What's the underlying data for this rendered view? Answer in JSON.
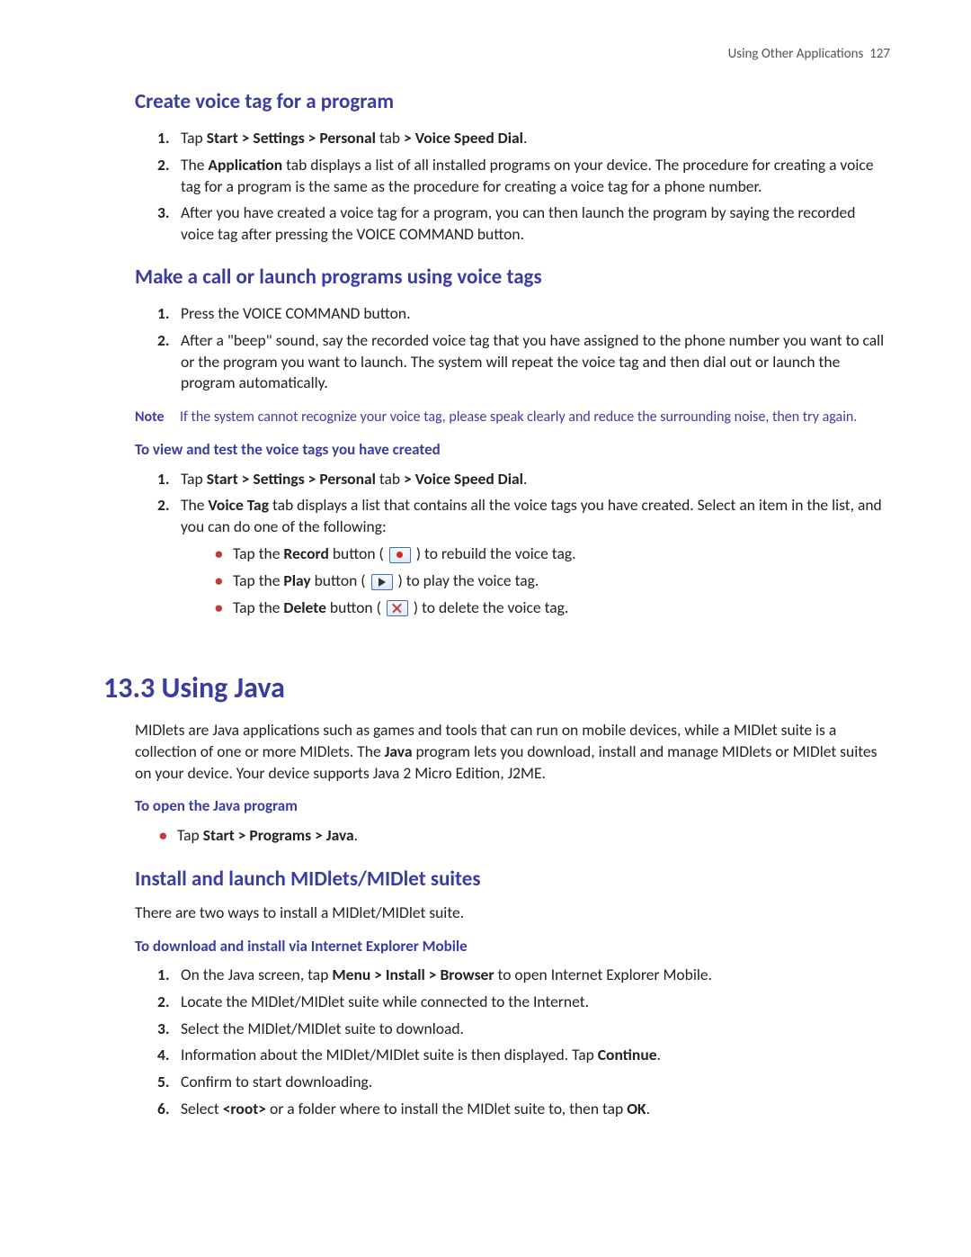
{
  "header": {
    "section": "Using Other Applications",
    "page": "127"
  },
  "s1": {
    "title": "Create voice tag for a program",
    "li1a": "Tap ",
    "li1b": "Start > Settings > Personal",
    "li1c": " tab ",
    "li1d": "> Voice Speed Dial",
    "li1e": ".",
    "li2a": "The ",
    "li2b": "Application",
    "li2c": " tab displays a list of all installed programs on your device. The procedure for creating a voice tag for a program is the same as the procedure for creating a voice tag for a phone number.",
    "li3": "After you have created a voice tag for a program, you can then launch the program by saying the recorded voice tag after pressing the VOICE COMMAND button."
  },
  "s2": {
    "title": "Make a call or launch programs using voice tags",
    "li1": "Press the VOICE COMMAND button.",
    "li2": "After a \"beep\" sound, say the recorded voice tag that you have assigned to the phone number you want to call or the program you want to launch. The system will repeat the voice tag and then dial out or launch the program automatically.",
    "note_label": "Note",
    "note": "If the system cannot recognize your voice tag, please speak clearly and reduce the surrounding noise, then try again.",
    "sub": "To view and test the voice tags you have created",
    "sub_li1a": "Tap ",
    "sub_li1b": "Start > Settings > Personal",
    "sub_li1c": " tab ",
    "sub_li1d": "> Voice Speed Dial",
    "sub_li1e": ".",
    "sub_li2a": "The ",
    "sub_li2b": "Voice Tag",
    "sub_li2c": " tab displays a list that contains all the voice tags you have created. Select an item in the list, and you can do one of the following:",
    "b1a": "Tap the ",
    "b1b": "Record",
    "b1c": " button ( ",
    "b1d": " ) to rebuild the voice tag.",
    "b2a": "Tap the ",
    "b2b": "Play",
    "b2c": " button ( ",
    "b2d": " ) to play the voice tag.",
    "b3a": "Tap the ",
    "b3b": "Delete",
    "b3c": " button ( ",
    "b3d": " ) to delete the voice tag."
  },
  "s3": {
    "title": "13.3  Using Java",
    "p1a": "MIDlets are Java applications such as games and tools that can run on mobile devices, while a MIDlet suite is a collection of one or more MIDlets. The ",
    "p1b": "Java",
    "p1c": " program lets you download, install and manage MIDlets or MIDlet suites on your device. Your device supports Java 2 Micro Edition, J2ME.",
    "sub": "To open the Java program",
    "b1a": "Tap ",
    "b1b": "Start > Programs > Java",
    "b1c": "."
  },
  "s4": {
    "title": "Install and launch MIDlets/MIDlet suites",
    "p": "There are two ways to install a MIDlet/MIDlet suite.",
    "sub": "To download and install via Internet Explorer Mobile",
    "li1a": "On the Java screen, tap ",
    "li1b": "Menu > Install > Browser",
    "li1c": " to open Internet Explorer Mobile.",
    "li2": "Locate the MIDlet/MIDlet suite while connected to the Internet.",
    "li3": "Select the MIDlet/MIDlet suite to download.",
    "li4a": "Information about the MIDlet/MIDlet suite is then displayed. Tap ",
    "li4b": "Continue",
    "li4c": ".",
    "li5": "Confirm to start downloading.",
    "li6a": "Select ",
    "li6b": "<root>",
    "li6c": " or a folder where to install the MIDlet suite to, then tap ",
    "li6d": "OK",
    "li6e": "."
  }
}
